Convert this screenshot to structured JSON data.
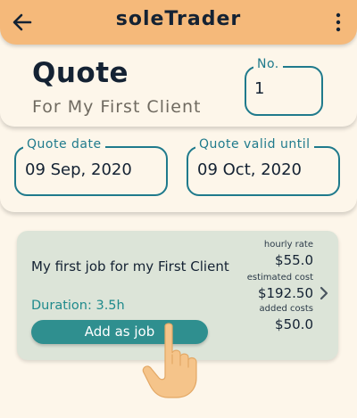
{
  "appbar": {
    "title": "soleTrader",
    "back_icon": "arrow-left-icon",
    "menu_icon": "more-vert-icon",
    "color": "#f5b97a"
  },
  "quote": {
    "heading": "Quote",
    "client_line": "For My First Client",
    "number_label": "No.",
    "number_value": "1"
  },
  "dates": {
    "quote_date_label": "Quote date",
    "quote_date_value": "09 Sep, 2020",
    "valid_until_label": "Quote valid until",
    "valid_until_value": "09 Oct, 2020"
  },
  "job": {
    "description": "My first job for my First Client",
    "duration": "Duration: 3.5h",
    "add_button_label": "Add as job",
    "hourly_rate_label": "hourly rate",
    "hourly_rate_value": "$55.0",
    "estimated_cost_label": "estimated cost",
    "estimated_cost_value": "$192.50",
    "added_costs_label": "added costs",
    "added_costs_value": "$50.0",
    "chevron_icon": "chevron-right-icon",
    "card_color": "#dce4d8",
    "button_color": "#2f8f8f"
  },
  "accent_color": "#1f7a8c",
  "pointer_icon": "pointing-hand-icon"
}
